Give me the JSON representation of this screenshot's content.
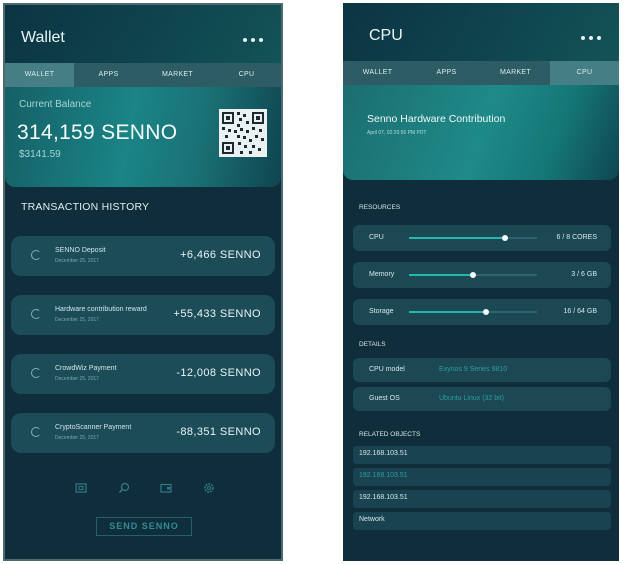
{
  "tabs": [
    "WALLET",
    "APPS",
    "MARKET",
    "CPU"
  ],
  "wallet": {
    "title": "Wallet",
    "current_balance_label": "Current Balance",
    "balance": "314,159 SENNO",
    "balance_usd": "$3141.59",
    "history_title": "TRANSACTION HISTORY",
    "transactions": [
      {
        "name": "SENNO Deposit",
        "date": "December 25, 2017",
        "amount": "+6,466 SENNO"
      },
      {
        "name": "Hardware contribution reward",
        "date": "December 25, 2017",
        "amount": "+55,433 SENNO"
      },
      {
        "name": "CrowdWiz Payment",
        "date": "December 25, 2017",
        "amount": "-12,008 SENNO"
      },
      {
        "name": "CryptoScanner Payment",
        "date": "December 25, 2017",
        "amount": "-88,351 SENNO"
      }
    ],
    "bottom_icons": [
      "wallet-icon",
      "search-icon",
      "card-icon",
      "settings-icon"
    ],
    "send_button": "SEND SENNO"
  },
  "cpu": {
    "title": "CPU",
    "banner_title": "Senno Hardware Contribution",
    "banner_subtitle": "April 07, 02:20:56 PM PDT",
    "resources_label": "RESOURCES",
    "resources": [
      {
        "label": "CPU",
        "value": "6 / 8 CORES",
        "fraction": 0.75
      },
      {
        "label": "Memory",
        "value": "3 / 6 GB",
        "fraction": 0.5
      },
      {
        "label": "Storage",
        "value": "16 / 64 GB",
        "fraction": 0.6
      }
    ],
    "details_label": "DETAILS",
    "details": [
      {
        "label": "CPU model",
        "value": "Exynos 9 Series 9810"
      },
      {
        "label": "Guest OS",
        "value": "Ubuntu Linux (32 bit)"
      }
    ],
    "related_label": "RELATED OBJECTS",
    "related": [
      "192.168.103.51",
      "192.168.103.51",
      "192.168.103.51",
      "Network"
    ]
  },
  "colors": {
    "accent": "#1a8486",
    "panel": "#0f2d3a"
  }
}
